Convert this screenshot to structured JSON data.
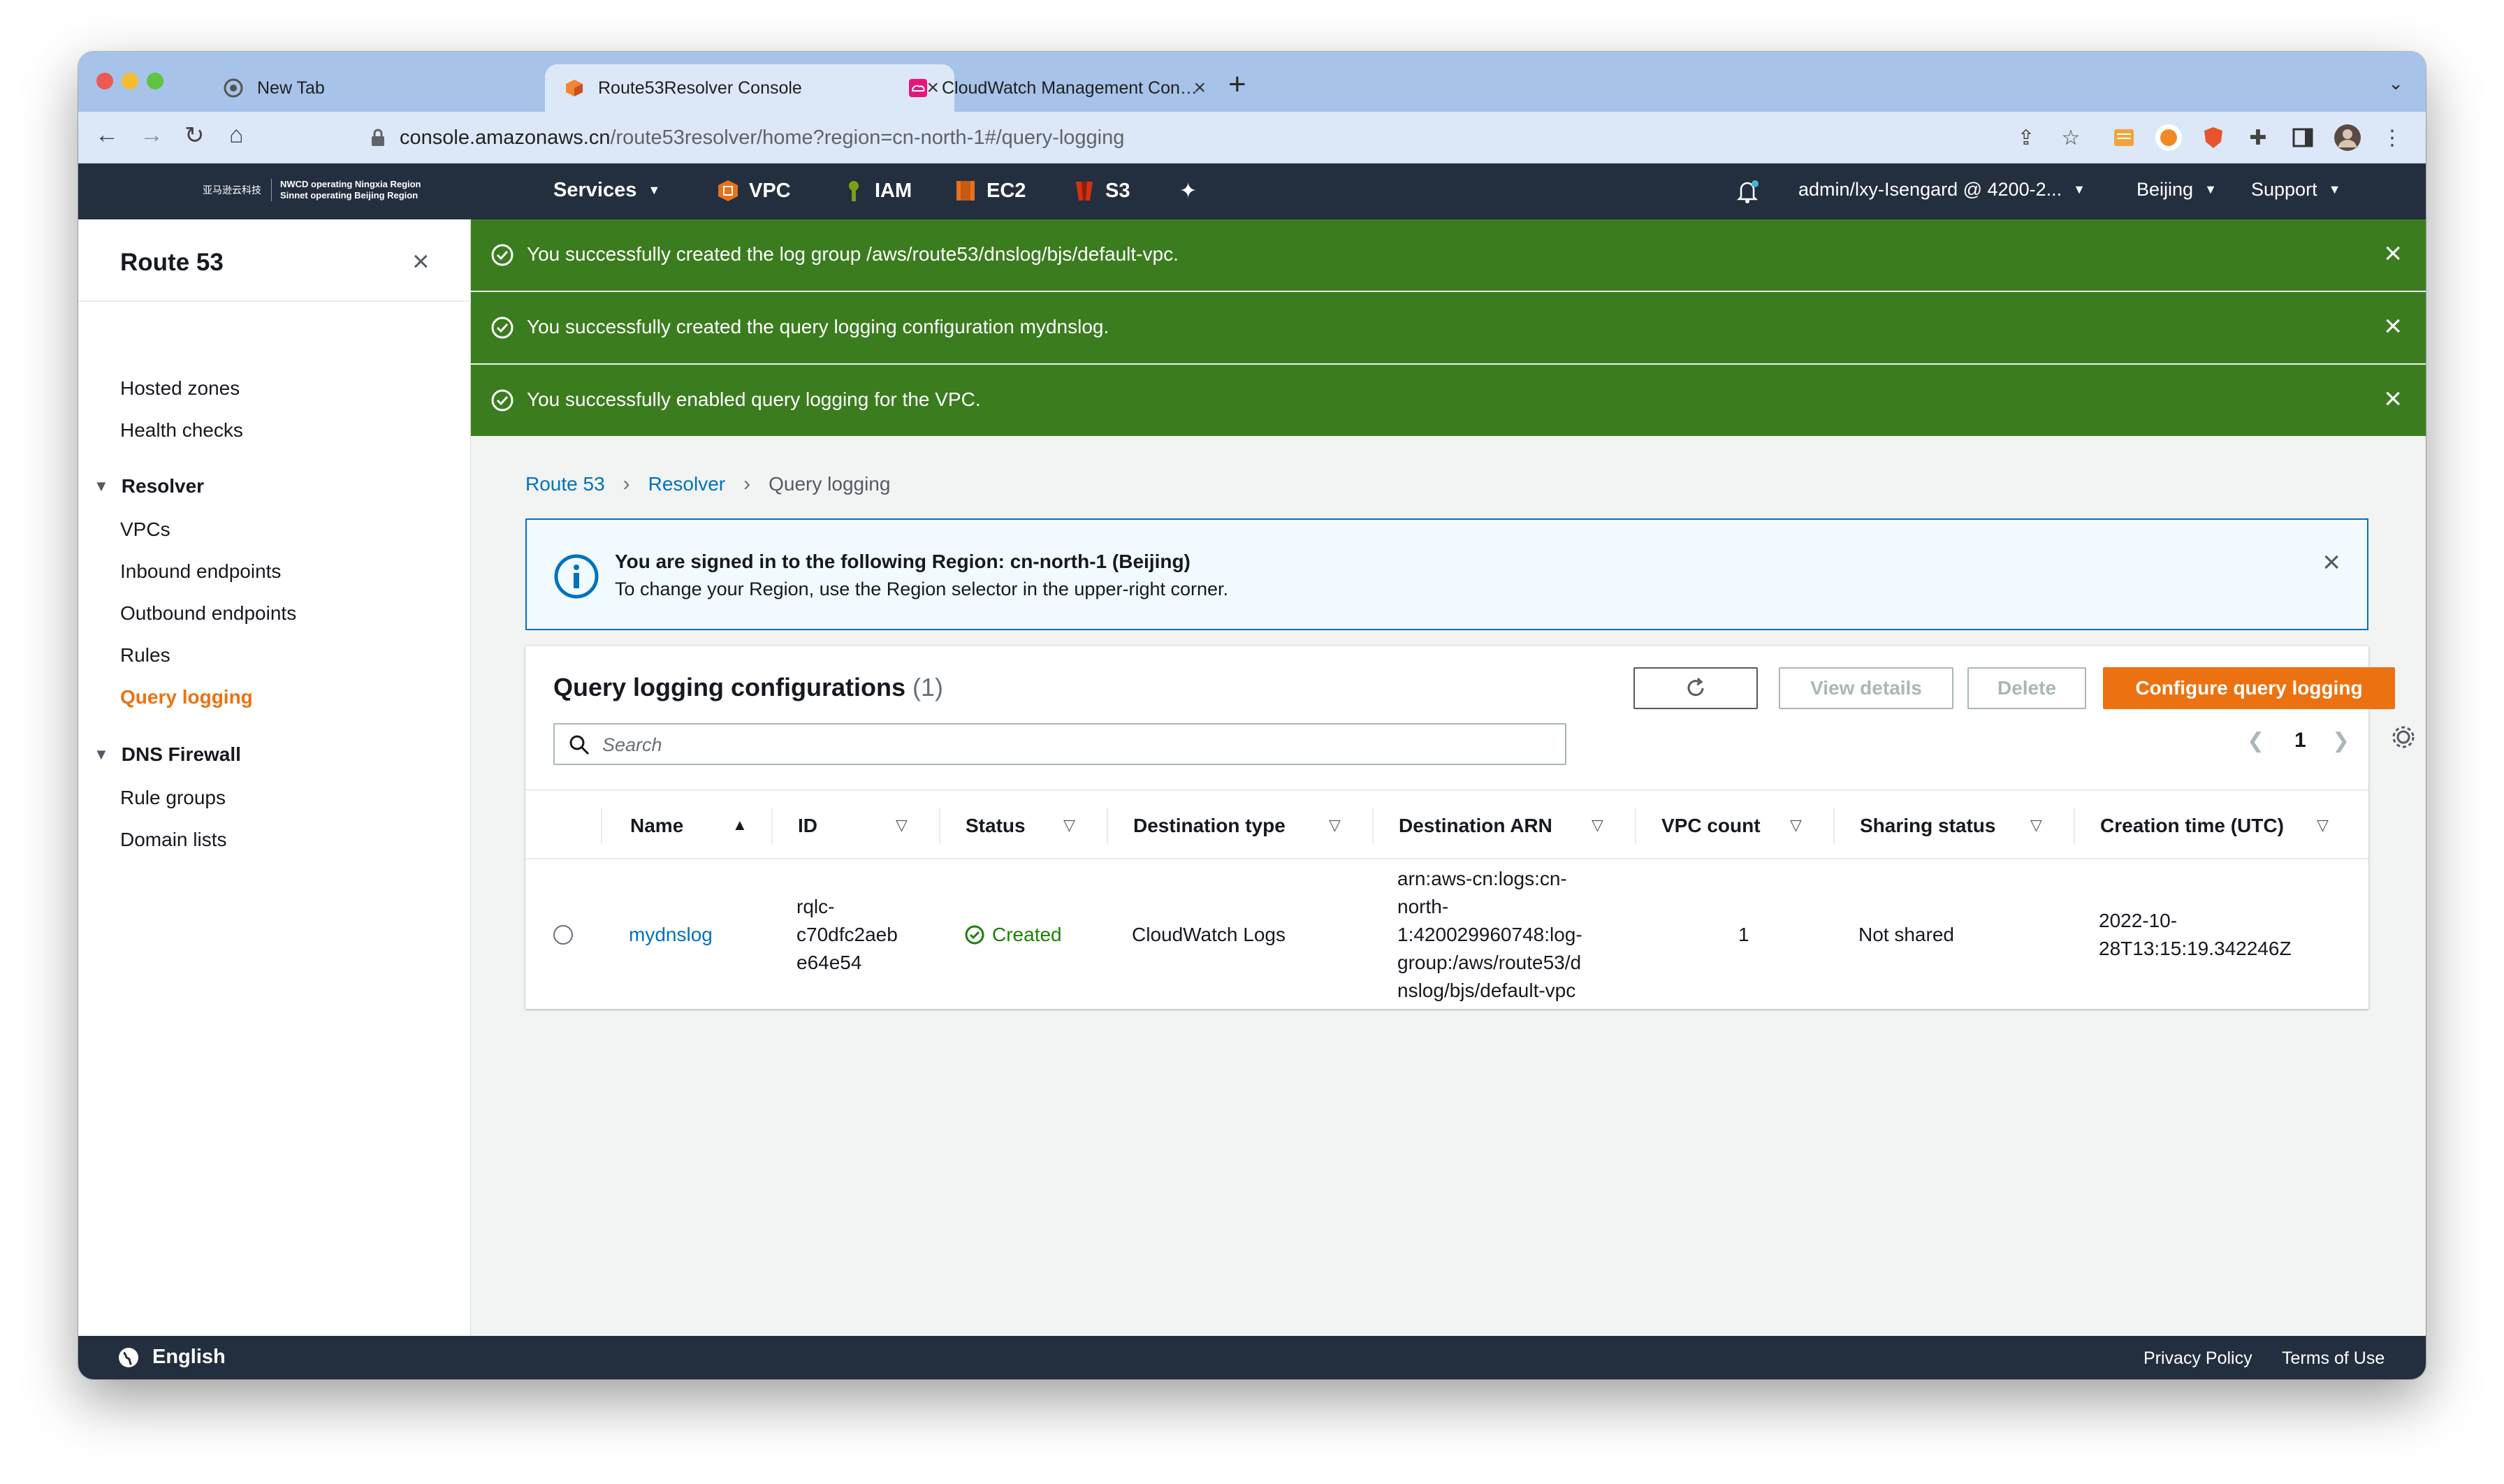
{
  "browser": {
    "tabs": [
      {
        "title": "New Tab",
        "close": "×"
      },
      {
        "title": "Route53Resolver Console",
        "close": "×"
      },
      {
        "title": "CloudWatch Management Con…",
        "close": "×"
      }
    ],
    "new_tab": "+",
    "tab_menu": "⌄",
    "url_host": "console.amazonaws.cn",
    "url_path": "/route53resolver/home?region=cn-north-1#/query-logging"
  },
  "aws_nav": {
    "logo_cn": "亚马逊云科技",
    "logo_line1": "NWCD operating Ningxia Region",
    "logo_line2": "Sinnet operating Beijing Region",
    "services": "Services",
    "favorites": [
      "VPC",
      "IAM",
      "EC2",
      "S3"
    ],
    "account": "admin/lxy-Isengard @ 4200-2...",
    "region": "Beijing",
    "support": "Support",
    "colors": {
      "vpc": "#e7711b",
      "iam": "#7aa116",
      "ec2": "#e7711b",
      "s3": "#d13212"
    }
  },
  "sidebar": {
    "title": "Route 53",
    "close": "×",
    "items": [
      "Hosted zones",
      "Health checks"
    ],
    "resolver_section": "Resolver",
    "resolver_items": [
      "VPCs",
      "Inbound endpoints",
      "Outbound endpoints",
      "Rules",
      "Query logging"
    ],
    "firewall_section": "DNS Firewall",
    "firewall_items": [
      "Rule groups",
      "Domain lists"
    ]
  },
  "flash": [
    {
      "message": "You successfully created the log group /aws/route53/dnslog/bjs/default-vpc."
    },
    {
      "message": "You successfully created the query logging configuration mydnslog."
    },
    {
      "message": "You successfully enabled query logging for the VPC."
    }
  ],
  "breadcrumb": {
    "items": [
      "Route 53",
      "Resolver"
    ],
    "current": "Query logging",
    "sep": "›"
  },
  "alert": {
    "title": "You are signed in to the following Region: cn-north-1 (Beijing)",
    "body": "To change your Region, use the Region selector in the upper-right corner."
  },
  "table": {
    "title": "Query logging configurations",
    "count": "(1)",
    "buttons": {
      "view": "View details",
      "delete": "Delete",
      "configure": "Configure query logging"
    },
    "search_placeholder": "Search",
    "page": "1",
    "columns": [
      "Name",
      "ID",
      "Status",
      "Destination type",
      "Destination ARN",
      "VPC count",
      "Sharing status",
      "Creation time (UTC)"
    ],
    "rows": [
      {
        "name": "mydnslog",
        "id": [
          "rqlc-",
          "c70dfc2aeb",
          "e64e54"
        ],
        "status": "Created",
        "destination_type": "CloudWatch Logs",
        "destination_arn": [
          "arn:aws-cn:logs:cn-",
          "north-",
          "1:420029960748:log-",
          "group:/aws/route53/d",
          "nslog/bjs/default-vpc"
        ],
        "vpc_count": "1",
        "sharing_status": "Not shared",
        "creation_time": [
          "2022-10-",
          "28T13:15:19.342246Z"
        ]
      }
    ]
  },
  "footer": {
    "language": "English",
    "privacy": "Privacy Policy",
    "terms": "Terms of Use"
  }
}
